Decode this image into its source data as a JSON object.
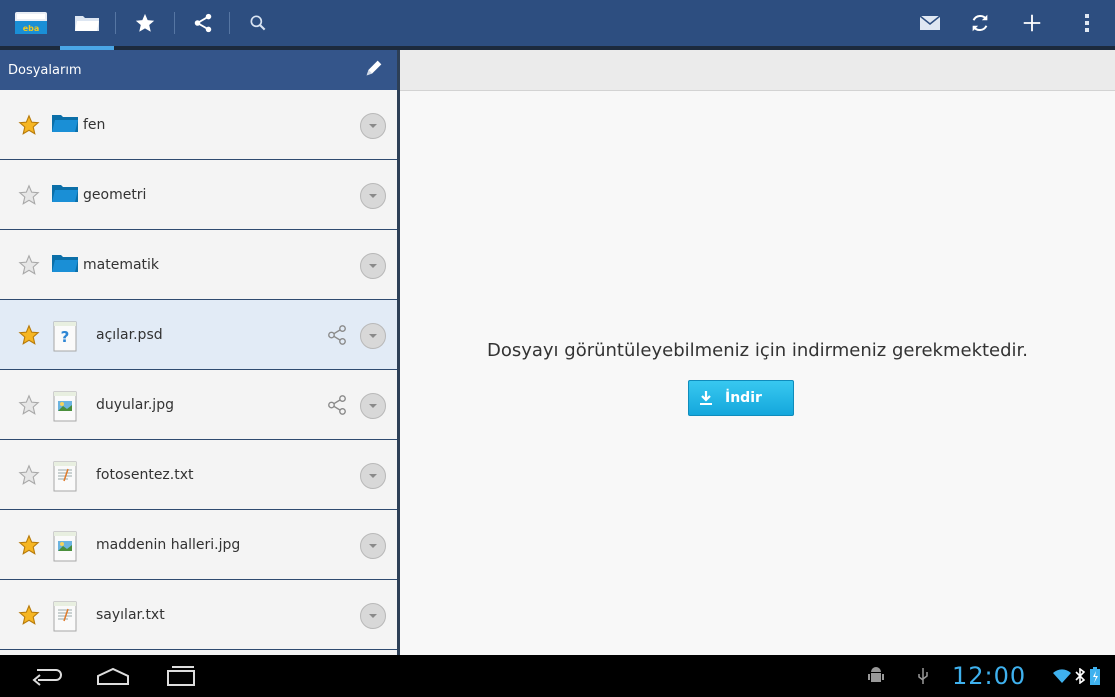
{
  "app": {
    "title": "eba"
  },
  "sidebar": {
    "title": "Dosyalarım",
    "items": [
      {
        "name": "fen",
        "type": "folder",
        "starred": true,
        "shared": false,
        "selected": false
      },
      {
        "name": "geometri",
        "type": "folder",
        "starred": false,
        "shared": false,
        "selected": false
      },
      {
        "name": "matematik",
        "type": "folder",
        "starred": false,
        "shared": false,
        "selected": false
      },
      {
        "name": "açılar.psd",
        "type": "psd",
        "starred": true,
        "shared": true,
        "selected": true
      },
      {
        "name": "duyular.jpg",
        "type": "jpg",
        "starred": false,
        "shared": true,
        "selected": false
      },
      {
        "name": "fotosentez.txt",
        "type": "txt",
        "starred": false,
        "shared": false,
        "selected": false
      },
      {
        "name": "maddenin halleri.jpg",
        "type": "jpg",
        "starred": true,
        "shared": false,
        "selected": false
      },
      {
        "name": "sayılar.txt",
        "type": "txt",
        "starred": true,
        "shared": false,
        "selected": false
      }
    ]
  },
  "content": {
    "message": "Dosyayı görüntüleyebilmeniz için indirmeniz gerekmektedir.",
    "download_label": "İndir"
  },
  "status": {
    "time": "12:00"
  },
  "colors": {
    "topbar": "#2d4e80",
    "accent": "#4aa6e6",
    "button": "#1fb4e4",
    "clock": "#3fb1ee"
  }
}
